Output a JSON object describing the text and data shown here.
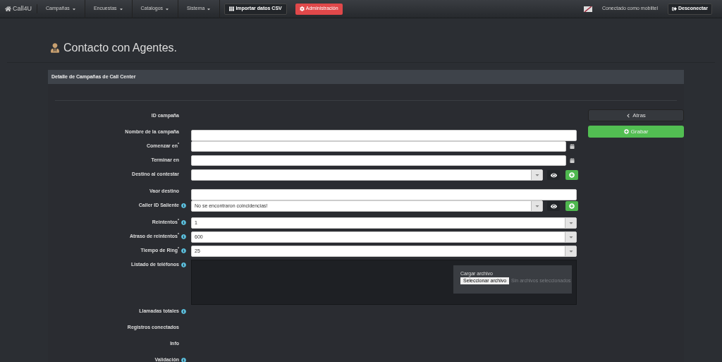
{
  "navbar": {
    "brand": "Call4U",
    "menus": [
      {
        "label": "Campañas"
      },
      {
        "label": "Encuestas"
      },
      {
        "label": "Catalogos"
      },
      {
        "label": "Sistema"
      }
    ],
    "import_button": "Importar datos CSV",
    "admin_button": "Administración",
    "user_text": "Conectado como mobiltel",
    "logout_button": "Desconectar"
  },
  "page_title": "Contacto con Agentes.",
  "panel": {
    "title": "Detalle de Campañas de Call Center",
    "fields": [
      {
        "kind": "static",
        "label": "ID campaña",
        "info": false
      },
      {
        "kind": "input",
        "label": "Nombre de la campaña",
        "info": false
      },
      {
        "kind": "date",
        "label": "Comenzar en$^{*}$",
        "info": false
      },
      {
        "kind": "date",
        "label": "Terminar en",
        "info": false
      },
      {
        "kind": "select-actions",
        "label": "Destino al contestar",
        "info": false
      },
      {
        "kind": "input",
        "label": "Vaor destino",
        "info": false
      },
      {
        "kind": "select-actions",
        "label": "Caller ID Saliente",
        "info": true,
        "value": "No se encontraron coincidencias!"
      },
      {
        "kind": "select",
        "label": "Reintentos$^{*}$",
        "info": true,
        "value": "1"
      },
      {
        "kind": "select",
        "label": "Atraso de reintentos$^{*}$",
        "info": true,
        "value": "600"
      },
      {
        "kind": "select",
        "label": "Tiempo de Ring$^{*}$",
        "info": true,
        "value": "25"
      },
      {
        "kind": "upload",
        "label": "Listado de teléfonos",
        "info": true,
        "upload_label": "Cargar archivo",
        "choose_button": "Seleccionar archivo",
        "file_status": "Sin archivos seleccionados"
      },
      {
        "kind": "static",
        "label": "Llamadas totales",
        "info": true
      },
      {
        "kind": "static",
        "label": "Registros conectados",
        "info": false
      },
      {
        "kind": "static",
        "label": "Info",
        "info": false
      },
      {
        "kind": "static",
        "label": "Validación",
        "info": true
      }
    ],
    "back_button": "Atras",
    "save_button": "Grabar"
  }
}
